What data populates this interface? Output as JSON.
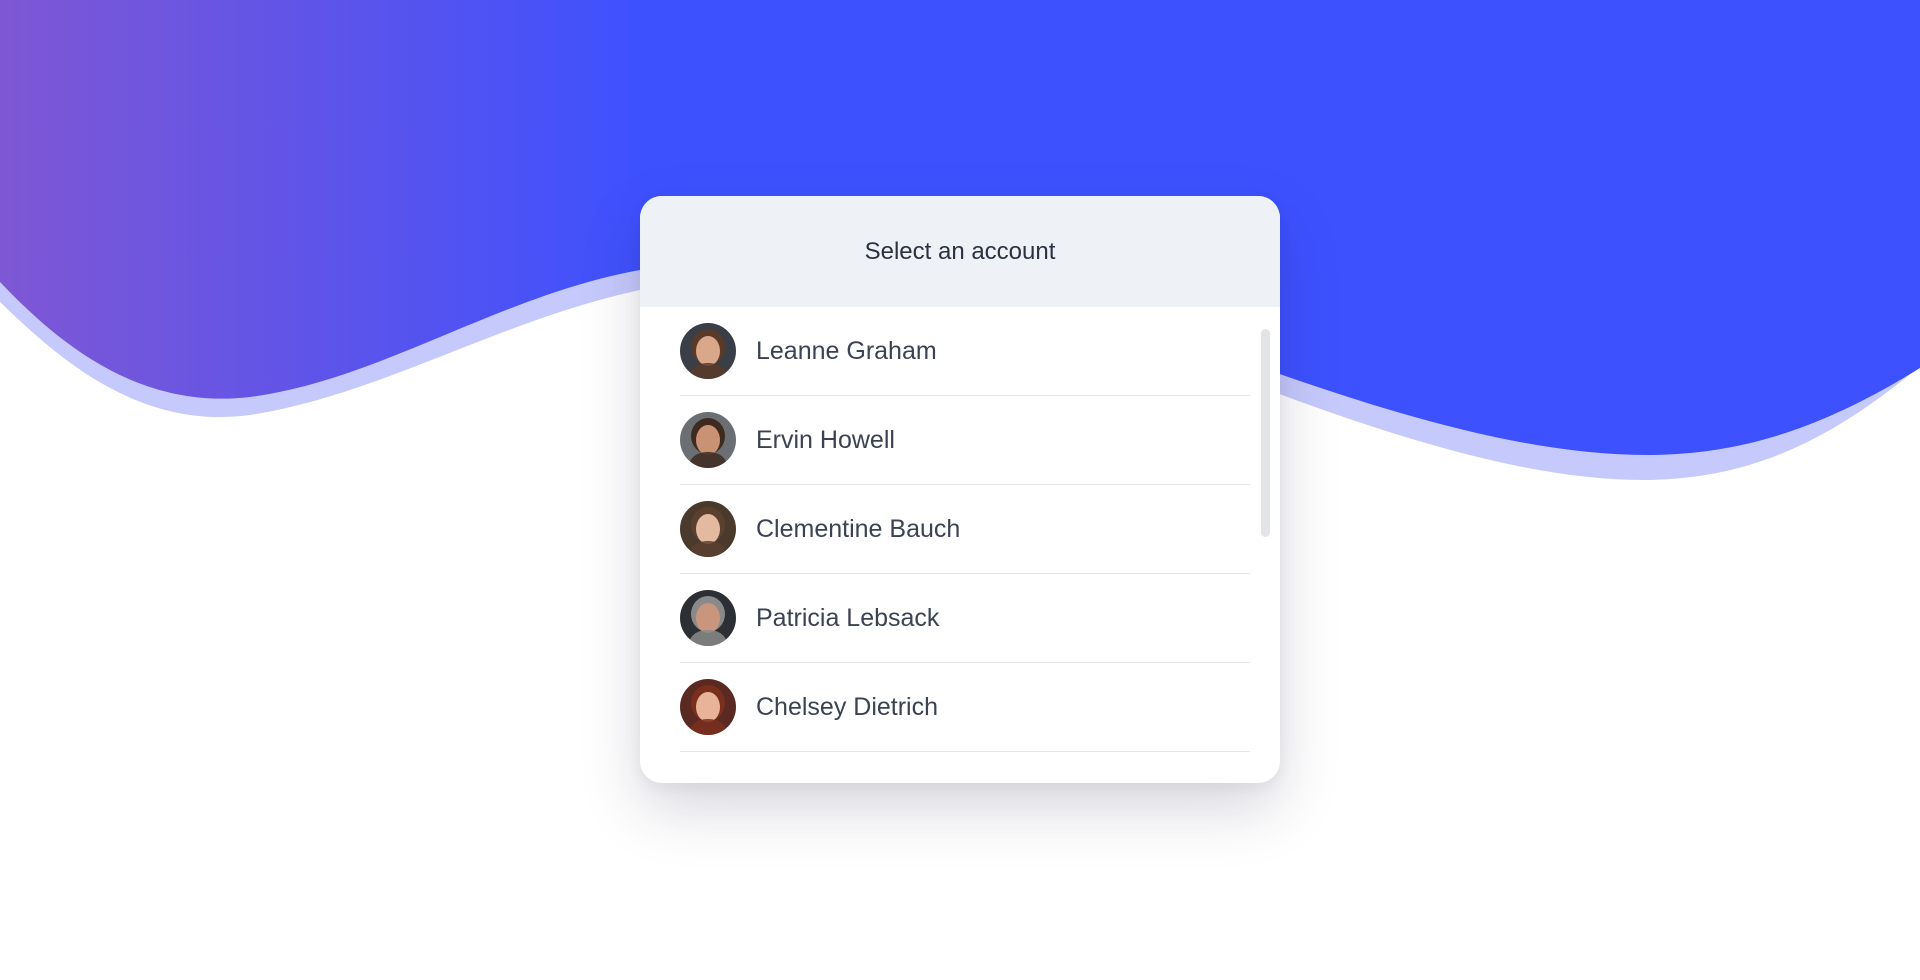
{
  "header": {
    "title": "Select an account"
  },
  "accounts": [
    {
      "name": "Leanne Graham",
      "avatar_icon": "avatar-photo",
      "skin": "#d9a88a",
      "hair": "#5a3b2a",
      "bg": "#3a3f47"
    },
    {
      "name": "Ervin Howell",
      "avatar_icon": "avatar-photo",
      "skin": "#c99275",
      "hair": "#3e2a1e",
      "bg": "#6b6f73"
    },
    {
      "name": "Clementine Bauch",
      "avatar_icon": "avatar-photo",
      "skin": "#e3b9a0",
      "hair": "#5b4030",
      "bg": "#4a3a2c"
    },
    {
      "name": "Patricia Lebsack",
      "avatar_icon": "avatar-photo",
      "skin": "#c9957d",
      "hair": "#8a8a8a",
      "bg": "#2c2f33"
    },
    {
      "name": "Chelsey Dietrich",
      "avatar_icon": "avatar-photo",
      "skin": "#e7b49a",
      "hair": "#7a2f1c",
      "bg": "#5a2a22"
    }
  ],
  "colors": {
    "wave_start": "#7e57d4",
    "wave_end": "#3d51ff",
    "wave_shadow": "#c6c9fb",
    "card_header_bg": "#eef2f7",
    "text": "#3b4252"
  }
}
